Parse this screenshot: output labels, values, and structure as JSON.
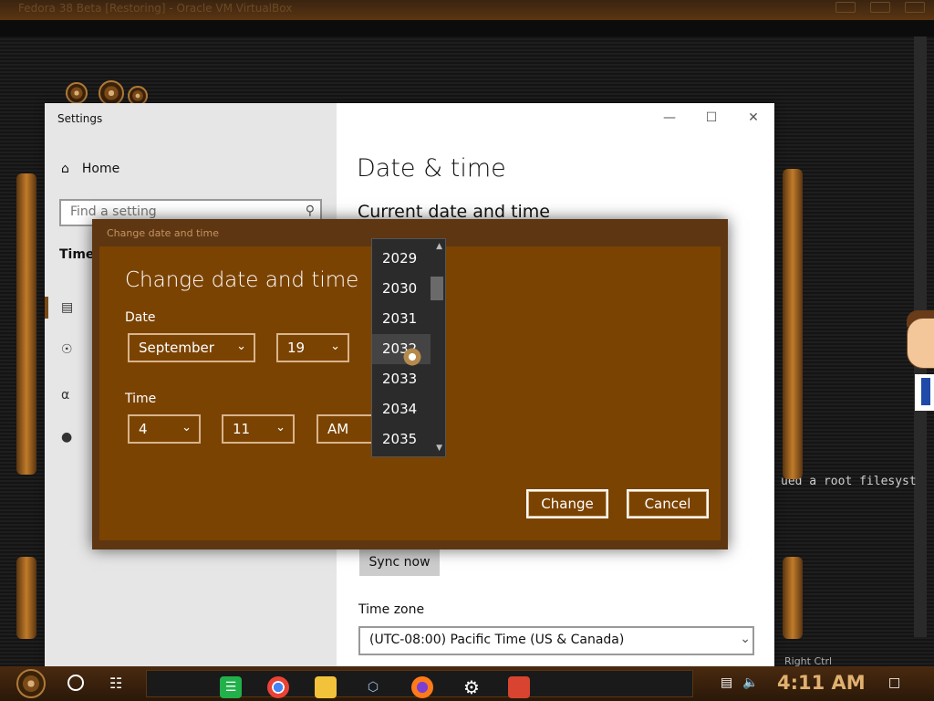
{
  "vbox": {
    "title": "Fedora 38 Beta [Restoring] - Oracle VM VirtualBox",
    "host_key": "Right Ctrl"
  },
  "terminal_text": "ued a root filesyst",
  "settings": {
    "window_title": "Settings",
    "home_label": "Home",
    "search_placeholder": "Find a setting",
    "section": "Time & Language",
    "page_title": "Date & time",
    "current_heading": "Current date and time",
    "sync_button": "Sync now",
    "timezone_label": "Time zone",
    "timezone_value": "(UTC-08:00) Pacific Time (US & Canada)"
  },
  "dialog": {
    "window_title": "Change date and time",
    "heading": "Change date and time",
    "date_label": "Date",
    "month": "September",
    "day": "19",
    "time_label": "Time",
    "hour": "4",
    "minute": "11",
    "ampm": "AM",
    "change_button": "Change",
    "cancel_button": "Cancel",
    "year_options": [
      "2029",
      "2030",
      "2031",
      "2032",
      "2033",
      "2034",
      "2035"
    ],
    "hovered_year": "2032"
  },
  "taskbar": {
    "clock": "4:11 AM",
    "apps": [
      "green-app",
      "chrome",
      "file-explorer",
      "virtualbox",
      "firefox",
      "settings",
      "red-app"
    ]
  },
  "colors": {
    "dialog_bg": "#7b4302",
    "dialog_frame": "#5e3612",
    "dropdown_bg": "#2b2b2b",
    "clock": "#e0b070"
  }
}
